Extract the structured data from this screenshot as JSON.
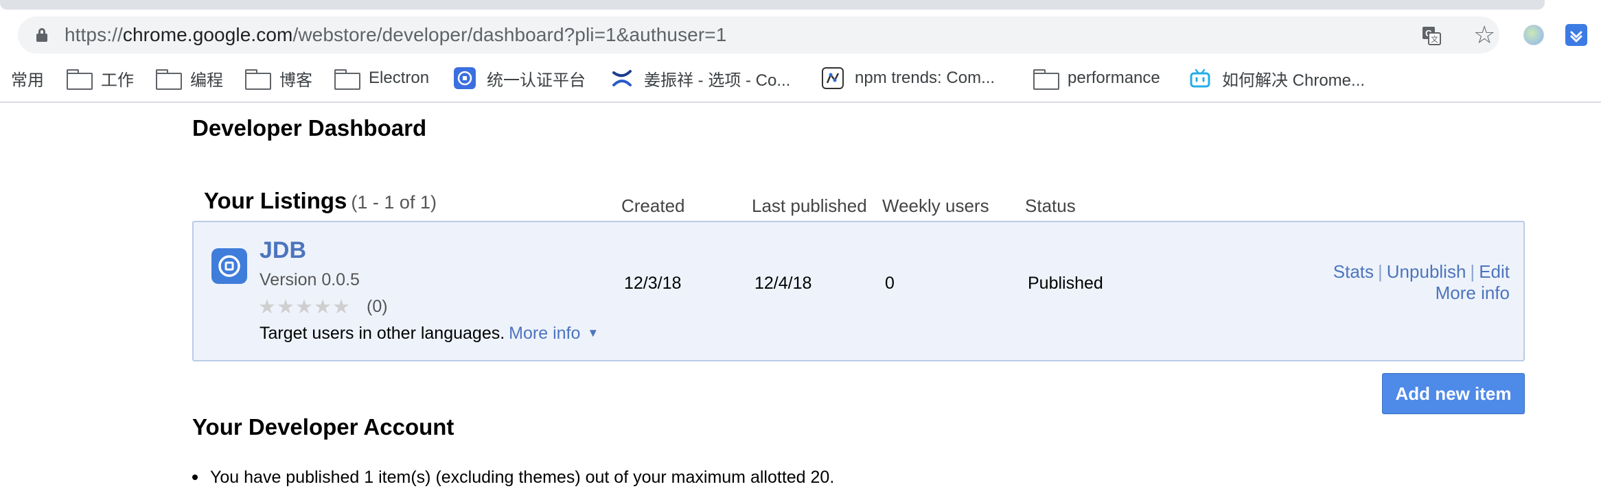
{
  "browser": {
    "url": {
      "scheme": "https://",
      "host": "chrome.google.com",
      "rest": "/webstore/developer/dashboard?pli=1&authuser=1"
    },
    "icons": [
      "lock-icon",
      "translate-icon",
      "star-icon",
      "profile-extension-icon",
      "pocket-extension-icon"
    ]
  },
  "bookmarks": [
    {
      "label": "常用",
      "icon": "none"
    },
    {
      "label": "工作",
      "icon": "folder-icon"
    },
    {
      "label": "编程",
      "icon": "folder-icon"
    },
    {
      "label": "博客",
      "icon": "folder-icon"
    },
    {
      "label": "Electron",
      "icon": "folder-icon"
    },
    {
      "label": "统一认证平台",
      "icon": "auth-favicon"
    },
    {
      "label": "姜振祥 - 选项 - Co...",
      "icon": "confluence-favicon"
    },
    {
      "label": "npm trends: Com...",
      "icon": "npm-trends-favicon"
    },
    {
      "label": "performance",
      "icon": "folder-icon"
    },
    {
      "label": "如何解决 Chrome...",
      "icon": "bilibili-favicon"
    }
  ],
  "page": {
    "title": "Developer Dashboard",
    "listings": {
      "heading": "Your Listings",
      "count": "(1 - 1 of 1)",
      "columns": {
        "created": "Created",
        "last_published": "Last published",
        "weekly_users": "Weekly users",
        "status": "Status"
      },
      "items": [
        {
          "name": "JDB",
          "version": "Version 0.0.5",
          "stars": "★★★★★",
          "rating_value": 0,
          "rating_count": "(0)",
          "target_text": "Target users in other languages.",
          "target_more": "More info",
          "target_arrow": "▼",
          "created": "12/3/18",
          "last_published": "12/4/18",
          "weekly_users": "0",
          "status": "Published",
          "actions": {
            "stats": "Stats",
            "unpublish": "Unpublish",
            "edit": "Edit",
            "separator": "|",
            "more_info": "More info"
          }
        }
      ],
      "add_button": "Add new item"
    },
    "account": {
      "heading": "Your Developer Account",
      "items": [
        "You have published 1 item(s) (excluding themes) out of your maximum allotted 20."
      ]
    }
  },
  "colors": {
    "link": "#4d74bd",
    "listing_bg": "#eef3fb",
    "listing_border": "#b9cbe7",
    "button_bg": "#4e8ae8"
  }
}
